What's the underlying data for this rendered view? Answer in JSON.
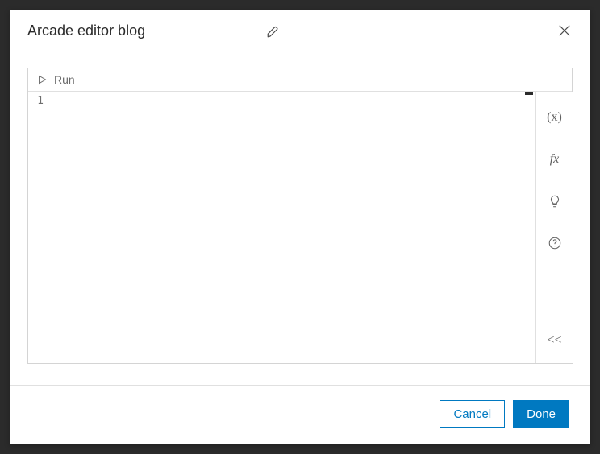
{
  "header": {
    "title": "Arcade editor blog"
  },
  "toolbar": {
    "run_label": "Run"
  },
  "editor": {
    "line_number": "1",
    "content": ""
  },
  "sidetools": {
    "vars": "(x)",
    "fx": "fx",
    "collapse": "<<"
  },
  "footer": {
    "cancel_label": "Cancel",
    "done_label": "Done"
  }
}
